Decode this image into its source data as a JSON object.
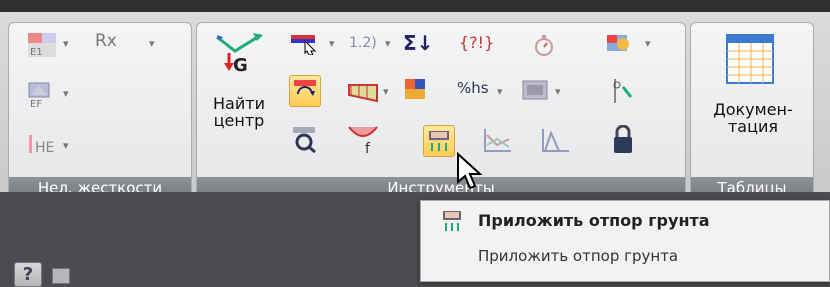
{
  "groups": {
    "stiffness": {
      "label": "Нел. жесткости",
      "items": {
        "e1": "E1",
        "rx": "Rx",
        "ef": "EF",
        "he": "HE"
      }
    },
    "tools": {
      "label": "Инструменты",
      "find_center": "Найти центр",
      "items": {
        "sigma": "Σ↓",
        "q12": "1.2)",
        "pq": "{?!}",
        "percent_hs": "%hs",
        "pf": "f"
      }
    },
    "tables": {
      "label": "Таблицы",
      "doc_button": "Докумен- тация"
    }
  },
  "tooltip": {
    "title": "Приложить отпор грунта",
    "description": "Приложить отпор грунта"
  },
  "status": {
    "help": "?"
  },
  "colors": {
    "accent": "#ffcc55",
    "panel": "#eef0f2",
    "group_bar": "#7f8286"
  }
}
